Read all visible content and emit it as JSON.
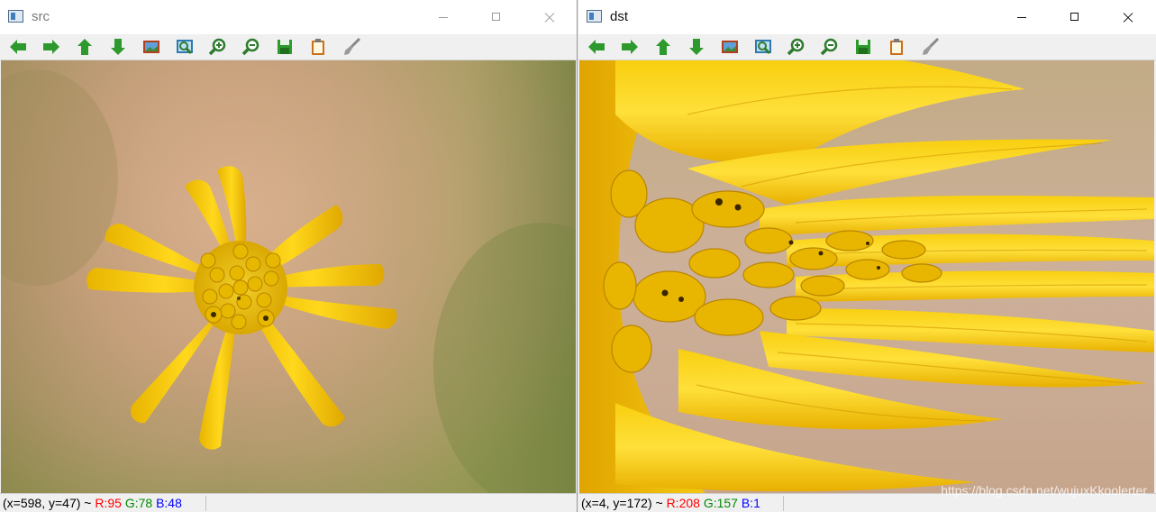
{
  "windows": {
    "src": {
      "title": "src",
      "status": {
        "coords": "(x=598, y=47) ~ ",
        "r": "R:95",
        "g": "G:78",
        "b": "B:48"
      }
    },
    "dst": {
      "title": "dst",
      "status": {
        "coords": "(x=4, y=172) ~ ",
        "r": "R:208",
        "g": "G:157",
        "b": "B:1"
      },
      "watermark": "https://blog.csdn.net/wujuxKkoolerter"
    }
  },
  "toolbar_icons": [
    "pan-left-icon",
    "pan-right-icon",
    "pan-up-icon",
    "pan-down-icon",
    "fit-window-icon",
    "zoom-area-icon",
    "zoom-in-icon",
    "zoom-out-icon",
    "save-icon",
    "copy-icon",
    "properties-icon"
  ],
  "colors": {
    "status_r": "#ff0000",
    "status_g": "#008a00",
    "status_b": "#0000ff",
    "toolbar_green": "#2e9a2e",
    "petal": "#f2c200",
    "petal_light": "#ffe24a"
  }
}
